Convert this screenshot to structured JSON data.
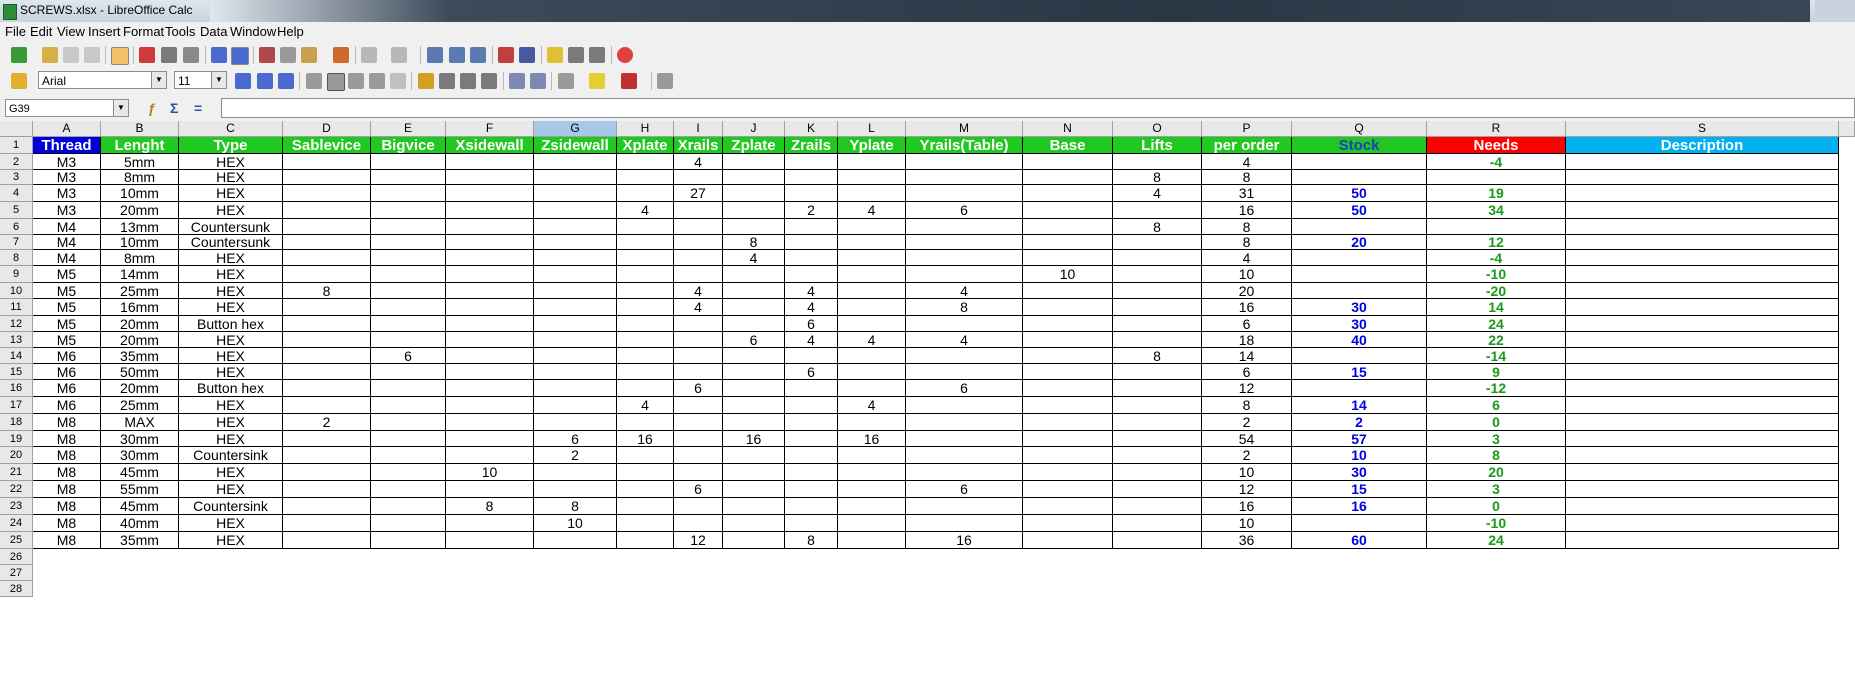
{
  "window": {
    "title": "SCREWS.xlsx - LibreOffice Calc"
  },
  "menu": [
    "File",
    "Edit",
    "View",
    "Insert",
    "Format",
    "Tools",
    "Data",
    "Window",
    "Help"
  ],
  "format_bar": {
    "font_name": "Arial",
    "font_size": "11"
  },
  "formula_bar": {
    "name_box": "G39",
    "formula": ""
  },
  "colors": {
    "header_green": "#21c821",
    "header_blue": "#0000d8",
    "header_red": "#ff0000",
    "header_cyan": "#00b0f0",
    "stock_text": "#0000e6",
    "needs_text": "#1a9a1a"
  },
  "sheet": {
    "selected_column": "G",
    "column_letters": [
      "A",
      "B",
      "C",
      "D",
      "E",
      "F",
      "G",
      "H",
      "I",
      "J",
      "K",
      "L",
      "M",
      "N",
      "O",
      "P",
      "Q",
      "R",
      "S"
    ],
    "row_numbers": [
      "1",
      "2",
      "3",
      "4",
      "5",
      "6",
      "7",
      "8",
      "9",
      "10",
      "11",
      "12",
      "13",
      "14",
      "15",
      "16",
      "17",
      "18",
      "19",
      "20",
      "21",
      "22",
      "23",
      "24",
      "25",
      "26",
      "27",
      "28"
    ],
    "headers": [
      "Thread",
      "Lenght",
      "Type",
      "Sablevice",
      "Bigvice",
      "Xsidewall",
      "Zsidewall",
      "Xplate",
      "Xrails",
      "Zplate",
      "Zrails",
      "Yplate",
      "Yrails(Table)",
      "Base",
      "Lifts",
      "per order",
      "Stock",
      "Needs",
      "Description"
    ],
    "rows": [
      [
        "M3",
        "5mm",
        "HEX",
        "",
        "",
        "",
        "",
        "",
        "4",
        "",
        "",
        "",
        "",
        "",
        "",
        "4",
        "",
        "-4",
        ""
      ],
      [
        "M3",
        "8mm",
        "HEX",
        "",
        "",
        "",
        "",
        "",
        "",
        "",
        "",
        "",
        "",
        "",
        "8",
        "8",
        "",
        "",
        ""
      ],
      [
        "M3",
        "10mm",
        "HEX",
        "",
        "",
        "",
        "",
        "",
        "27",
        "",
        "",
        "",
        "",
        "",
        "4",
        "31",
        "50",
        "19",
        ""
      ],
      [
        "M3",
        "20mm",
        "HEX",
        "",
        "",
        "",
        "",
        "4",
        "",
        "",
        "2",
        "4",
        "6",
        "",
        "",
        "16",
        "50",
        "34",
        ""
      ],
      [
        "M4",
        "13mm",
        "Countersunk",
        "",
        "",
        "",
        "",
        "",
        "",
        "",
        "",
        "",
        "",
        "",
        "8",
        "8",
        "",
        "",
        ""
      ],
      [
        "M4",
        "10mm",
        "Countersunk",
        "",
        "",
        "",
        "",
        "",
        "",
        "8",
        "",
        "",
        "",
        "",
        "",
        "8",
        "20",
        "12",
        ""
      ],
      [
        "M4",
        "8mm",
        "HEX",
        "",
        "",
        "",
        "",
        "",
        "",
        "4",
        "",
        "",
        "",
        "",
        "",
        "4",
        "",
        "-4",
        ""
      ],
      [
        "M5",
        "14mm",
        "HEX",
        "",
        "",
        "",
        "",
        "",
        "",
        "",
        "",
        "",
        "",
        "10",
        "",
        "10",
        "",
        "-10",
        ""
      ],
      [
        "M5",
        "25mm",
        "HEX",
        "8",
        "",
        "",
        "",
        "",
        "4",
        "",
        "4",
        "",
        "4",
        "",
        "",
        "20",
        "",
        "-20",
        ""
      ],
      [
        "M5",
        "16mm",
        "HEX",
        "",
        "",
        "",
        "",
        "",
        "4",
        "",
        "4",
        "",
        "8",
        "",
        "",
        "16",
        "30",
        "14",
        ""
      ],
      [
        "M5",
        "20mm",
        "Button hex",
        "",
        "",
        "",
        "",
        "",
        "",
        "",
        "6",
        "",
        "",
        "",
        "",
        "6",
        "30",
        "24",
        ""
      ],
      [
        "M5",
        "20mm",
        "HEX",
        "",
        "",
        "",
        "",
        "",
        "",
        "6",
        "4",
        "4",
        "4",
        "",
        "",
        "18",
        "40",
        "22",
        ""
      ],
      [
        "M6",
        "35mm",
        "HEX",
        "",
        "6",
        "",
        "",
        "",
        "",
        "",
        "",
        "",
        "",
        "",
        "8",
        "14",
        "",
        "-14",
        ""
      ],
      [
        "M6",
        "50mm",
        "HEX",
        "",
        "",
        "",
        "",
        "",
        "",
        "",
        "6",
        "",
        "",
        "",
        "",
        "6",
        "15",
        "9",
        ""
      ],
      [
        "M6",
        "20mm",
        "Button hex",
        "",
        "",
        "",
        "",
        "",
        "6",
        "",
        "",
        "",
        "6",
        "",
        "",
        "12",
        "",
        "-12",
        ""
      ],
      [
        "M6",
        "25mm",
        "HEX",
        "",
        "",
        "",
        "",
        "4",
        "",
        "",
        "",
        "4",
        "",
        "",
        "",
        "8",
        "14",
        "6",
        ""
      ],
      [
        "M8",
        "MAX",
        "HEX",
        "2",
        "",
        "",
        "",
        "",
        "",
        "",
        "",
        "",
        "",
        "",
        "",
        "2",
        "2",
        "0",
        ""
      ],
      [
        "M8",
        "30mm",
        "HEX",
        "",
        "",
        "",
        "6",
        "16",
        "",
        "16",
        "",
        "16",
        "",
        "",
        "",
        "54",
        "57",
        "3",
        ""
      ],
      [
        "M8",
        "30mm",
        "Countersink",
        "",
        "",
        "",
        "2",
        "",
        "",
        "",
        "",
        "",
        "",
        "",
        "",
        "2",
        "10",
        "8",
        ""
      ],
      [
        "M8",
        "45mm",
        "HEX",
        "",
        "",
        "10",
        "",
        "",
        "",
        "",
        "",
        "",
        "",
        "",
        "",
        "10",
        "30",
        "20",
        ""
      ],
      [
        "M8",
        "55mm",
        "HEX",
        "",
        "",
        "",
        "",
        "",
        "6",
        "",
        "",
        "",
        "6",
        "",
        "",
        "12",
        "15",
        "3",
        ""
      ],
      [
        "M8",
        "45mm",
        "Countersink",
        "",
        "",
        "8",
        "8",
        "",
        "",
        "",
        "",
        "",
        "",
        "",
        "",
        "16",
        "16",
        "0",
        ""
      ],
      [
        "M8",
        "40mm",
        "HEX",
        "",
        "",
        "",
        "10",
        "",
        "",
        "",
        "",
        "",
        "",
        "",
        "",
        "10",
        "",
        "-10",
        ""
      ],
      [
        "M8",
        "35mm",
        "HEX",
        "",
        "",
        "",
        "",
        "",
        "12",
        "",
        "8",
        "",
        "16",
        "",
        "",
        "36",
        "60",
        "24",
        ""
      ]
    ]
  }
}
